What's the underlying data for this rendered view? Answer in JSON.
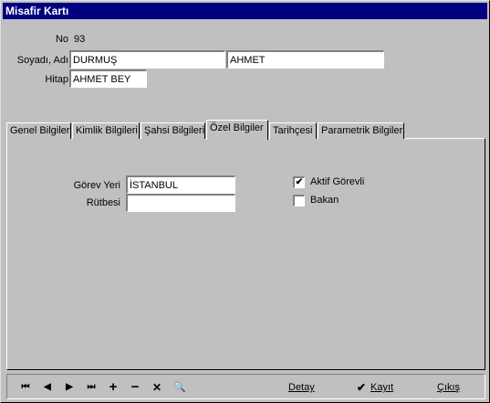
{
  "window": {
    "title": "Misafir Kartı"
  },
  "header": {
    "no_label": "No",
    "no_value": "93",
    "soyadi_label": "Soyadı, Adı",
    "soyadi_value": "DURMUŞ",
    "adi_value": "AHMET",
    "hitap_label": "Hitap",
    "hitap_value": "AHMET BEY"
  },
  "tabs": [
    {
      "label": "Genel Bilgiler"
    },
    {
      "label": "Kimlik Bilgileri"
    },
    {
      "label": "Şahsi Bilgileri"
    },
    {
      "label": "Özel Bilgiler"
    },
    {
      "label": "Tarihçesi"
    },
    {
      "label": "Parametrik Bilgiler"
    }
  ],
  "ozel": {
    "gorev_label": "Görev Yeri",
    "gorev_value": "İSTANBUL",
    "rutbe_label": "Rütbesi",
    "rutbe_value": "",
    "aktif_label": "Aktif Görevli",
    "aktif_checked": "✔",
    "bakan_label": "Bakan",
    "bakan_checked": ""
  },
  "toolbar": {
    "first": "⏮",
    "prev": "◀",
    "next": "▶",
    "last": "⏭",
    "add": "+",
    "remove": "−",
    "delete": "✕",
    "find": "🔍",
    "detay_label": "Detay",
    "kayit_label": "Kayıt",
    "kayit_icon": "✔",
    "cikis_label": "Çıkış"
  }
}
